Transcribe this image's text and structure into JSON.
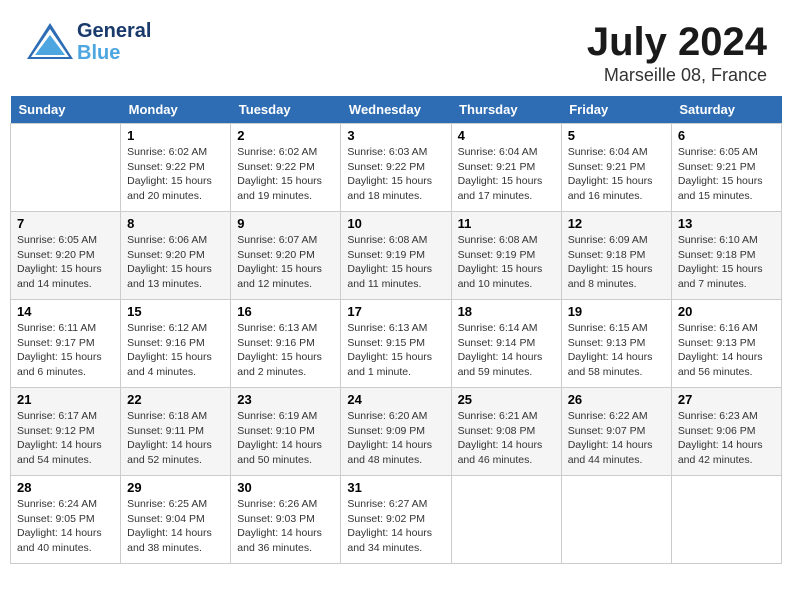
{
  "header": {
    "logo_line1": "General",
    "logo_line2": "Blue",
    "month": "July 2024",
    "location": "Marseille 08, France"
  },
  "weekdays": [
    "Sunday",
    "Monday",
    "Tuesday",
    "Wednesday",
    "Thursday",
    "Friday",
    "Saturday"
  ],
  "weeks": [
    [
      {
        "day": "",
        "info": ""
      },
      {
        "day": "1",
        "info": "Sunrise: 6:02 AM\nSunset: 9:22 PM\nDaylight: 15 hours\nand 20 minutes."
      },
      {
        "day": "2",
        "info": "Sunrise: 6:02 AM\nSunset: 9:22 PM\nDaylight: 15 hours\nand 19 minutes."
      },
      {
        "day": "3",
        "info": "Sunrise: 6:03 AM\nSunset: 9:22 PM\nDaylight: 15 hours\nand 18 minutes."
      },
      {
        "day": "4",
        "info": "Sunrise: 6:04 AM\nSunset: 9:21 PM\nDaylight: 15 hours\nand 17 minutes."
      },
      {
        "day": "5",
        "info": "Sunrise: 6:04 AM\nSunset: 9:21 PM\nDaylight: 15 hours\nand 16 minutes."
      },
      {
        "day": "6",
        "info": "Sunrise: 6:05 AM\nSunset: 9:21 PM\nDaylight: 15 hours\nand 15 minutes."
      }
    ],
    [
      {
        "day": "7",
        "info": "Sunrise: 6:05 AM\nSunset: 9:20 PM\nDaylight: 15 hours\nand 14 minutes."
      },
      {
        "day": "8",
        "info": "Sunrise: 6:06 AM\nSunset: 9:20 PM\nDaylight: 15 hours\nand 13 minutes."
      },
      {
        "day": "9",
        "info": "Sunrise: 6:07 AM\nSunset: 9:20 PM\nDaylight: 15 hours\nand 12 minutes."
      },
      {
        "day": "10",
        "info": "Sunrise: 6:08 AM\nSunset: 9:19 PM\nDaylight: 15 hours\nand 11 minutes."
      },
      {
        "day": "11",
        "info": "Sunrise: 6:08 AM\nSunset: 9:19 PM\nDaylight: 15 hours\nand 10 minutes."
      },
      {
        "day": "12",
        "info": "Sunrise: 6:09 AM\nSunset: 9:18 PM\nDaylight: 15 hours\nand 8 minutes."
      },
      {
        "day": "13",
        "info": "Sunrise: 6:10 AM\nSunset: 9:18 PM\nDaylight: 15 hours\nand 7 minutes."
      }
    ],
    [
      {
        "day": "14",
        "info": "Sunrise: 6:11 AM\nSunset: 9:17 PM\nDaylight: 15 hours\nand 6 minutes."
      },
      {
        "day": "15",
        "info": "Sunrise: 6:12 AM\nSunset: 9:16 PM\nDaylight: 15 hours\nand 4 minutes."
      },
      {
        "day": "16",
        "info": "Sunrise: 6:13 AM\nSunset: 9:16 PM\nDaylight: 15 hours\nand 2 minutes."
      },
      {
        "day": "17",
        "info": "Sunrise: 6:13 AM\nSunset: 9:15 PM\nDaylight: 15 hours\nand 1 minute."
      },
      {
        "day": "18",
        "info": "Sunrise: 6:14 AM\nSunset: 9:14 PM\nDaylight: 14 hours\nand 59 minutes."
      },
      {
        "day": "19",
        "info": "Sunrise: 6:15 AM\nSunset: 9:13 PM\nDaylight: 14 hours\nand 58 minutes."
      },
      {
        "day": "20",
        "info": "Sunrise: 6:16 AM\nSunset: 9:13 PM\nDaylight: 14 hours\nand 56 minutes."
      }
    ],
    [
      {
        "day": "21",
        "info": "Sunrise: 6:17 AM\nSunset: 9:12 PM\nDaylight: 14 hours\nand 54 minutes."
      },
      {
        "day": "22",
        "info": "Sunrise: 6:18 AM\nSunset: 9:11 PM\nDaylight: 14 hours\nand 52 minutes."
      },
      {
        "day": "23",
        "info": "Sunrise: 6:19 AM\nSunset: 9:10 PM\nDaylight: 14 hours\nand 50 minutes."
      },
      {
        "day": "24",
        "info": "Sunrise: 6:20 AM\nSunset: 9:09 PM\nDaylight: 14 hours\nand 48 minutes."
      },
      {
        "day": "25",
        "info": "Sunrise: 6:21 AM\nSunset: 9:08 PM\nDaylight: 14 hours\nand 46 minutes."
      },
      {
        "day": "26",
        "info": "Sunrise: 6:22 AM\nSunset: 9:07 PM\nDaylight: 14 hours\nand 44 minutes."
      },
      {
        "day": "27",
        "info": "Sunrise: 6:23 AM\nSunset: 9:06 PM\nDaylight: 14 hours\nand 42 minutes."
      }
    ],
    [
      {
        "day": "28",
        "info": "Sunrise: 6:24 AM\nSunset: 9:05 PM\nDaylight: 14 hours\nand 40 minutes."
      },
      {
        "day": "29",
        "info": "Sunrise: 6:25 AM\nSunset: 9:04 PM\nDaylight: 14 hours\nand 38 minutes."
      },
      {
        "day": "30",
        "info": "Sunrise: 6:26 AM\nSunset: 9:03 PM\nDaylight: 14 hours\nand 36 minutes."
      },
      {
        "day": "31",
        "info": "Sunrise: 6:27 AM\nSunset: 9:02 PM\nDaylight: 14 hours\nand 34 minutes."
      },
      {
        "day": "",
        "info": ""
      },
      {
        "day": "",
        "info": ""
      },
      {
        "day": "",
        "info": ""
      }
    ]
  ]
}
